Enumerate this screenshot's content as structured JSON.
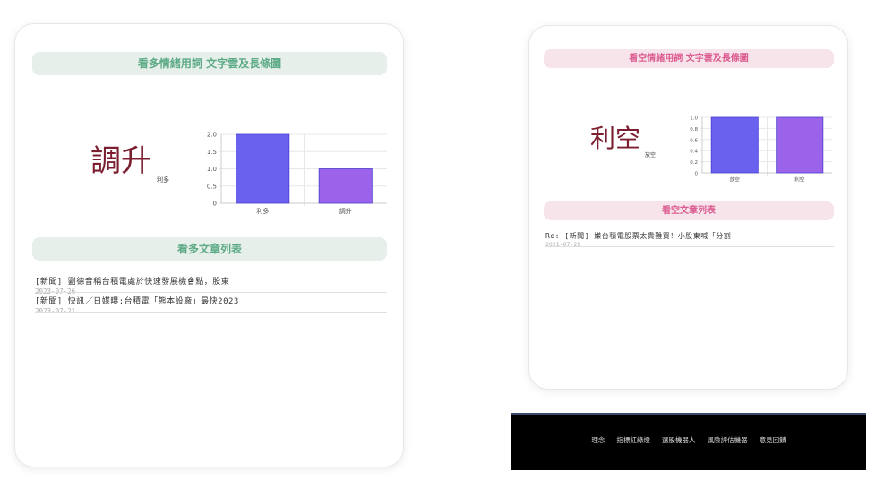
{
  "bullish": {
    "header": "看多情緒用詞 文字雲及長條圖",
    "wordcloud": {
      "big": "調升",
      "small": "利多"
    },
    "chart_data": {
      "type": "bar",
      "categories": [
        "利多",
        "調升"
      ],
      "values": [
        2,
        1
      ],
      "ylim": [
        0,
        2.0
      ],
      "yticks": [
        "0",
        "0.5",
        "1.0",
        "1.5",
        "2.0"
      ],
      "colors": [
        "#6a61ef",
        "#9b62ea"
      ],
      "grid": true
    },
    "list_header": "看多文章列表",
    "articles": [
      {
        "title": "[新聞] 劉德音稱台積電處於快速發展機會點，股東",
        "date": "2023-07-26"
      },
      {
        "title": "[新聞] 快訊／日媒曝:台積電「熊本設廠」最快2023",
        "date": "2023-07-21"
      }
    ]
  },
  "bearish": {
    "header": "看空情緒用詞 文字雲及長條圖",
    "wordcloud": {
      "big": "利空",
      "small": "放空"
    },
    "chart_data": {
      "type": "bar",
      "categories": [
        "放空",
        "利空"
      ],
      "values": [
        1,
        1
      ],
      "ylim": [
        0,
        1.0
      ],
      "yticks": [
        "0",
        "0.2",
        "0.4",
        "0.6",
        "0.8",
        "1.0"
      ],
      "colors": [
        "#6a61ef",
        "#9b62ea"
      ],
      "grid": true
    },
    "list_header": "看空文章列表",
    "articles": [
      {
        "title": "Re: [新聞] 嫌台積電股票太貴難買！小股東喊「分割",
        "date": "2021-07-29"
      }
    ]
  },
  "footer": {
    "links": [
      "理念",
      "指標紅綠燈",
      "選股機器人",
      "風險評估機器",
      "意見回饋"
    ]
  }
}
